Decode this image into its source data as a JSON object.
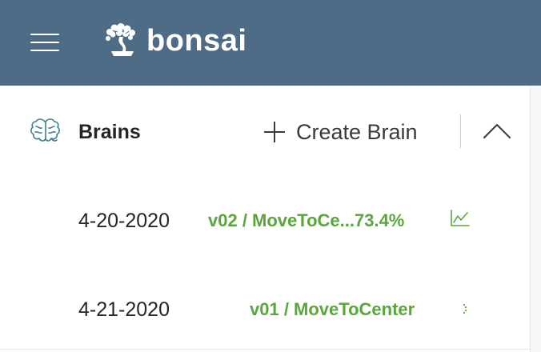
{
  "header": {
    "logo_text": "bonsai"
  },
  "brains_panel": {
    "title": "Brains",
    "create_label": "Create Brain"
  },
  "brains": [
    {
      "date": "4-20-2020",
      "version_label": "v02 / MoveToCe...73.4%"
    },
    {
      "date": "4-21-2020",
      "version_label": "v01 / MoveToCenter"
    }
  ],
  "colors": {
    "header_bg": "#4f6c86",
    "accent_green": "#5aa53c",
    "brain_icon": "#3f7e8e"
  }
}
